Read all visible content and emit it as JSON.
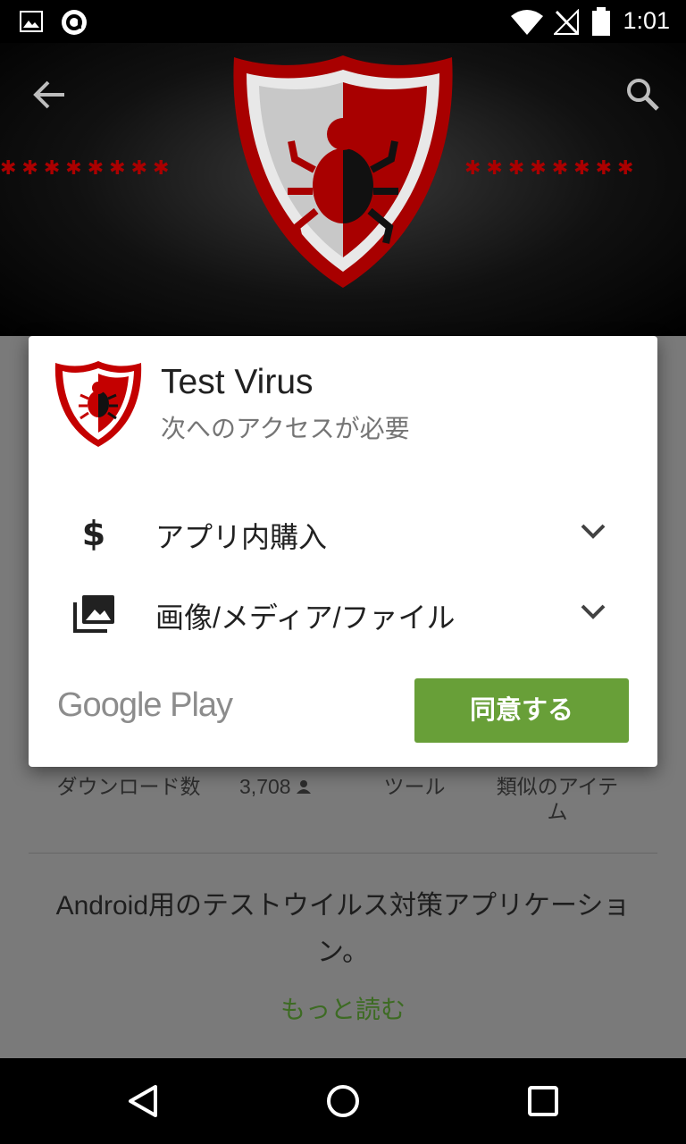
{
  "status_bar": {
    "time": "1:01"
  },
  "background_page": {
    "stats": [
      {
        "label": "ダウンロード数"
      },
      {
        "label": "3,708"
      },
      {
        "label": "ツール"
      },
      {
        "label": "類似のアイテム"
      }
    ],
    "description": "Android用のテストウイルス対策アプリケーション。",
    "more_link": "もっと読む"
  },
  "dialog": {
    "app_title": "Test Virus",
    "subtitle": "次へのアクセスが必要",
    "permissions": [
      {
        "label": "アプリ内購入",
        "icon": "dollar-icon"
      },
      {
        "label": "画像/メディア/ファイル",
        "icon": "photo-library-icon"
      }
    ],
    "footer_logo": "Google Play",
    "agree_button": "同意する"
  },
  "colors": {
    "accent": "#689f38",
    "brand_red": "#c40000"
  }
}
